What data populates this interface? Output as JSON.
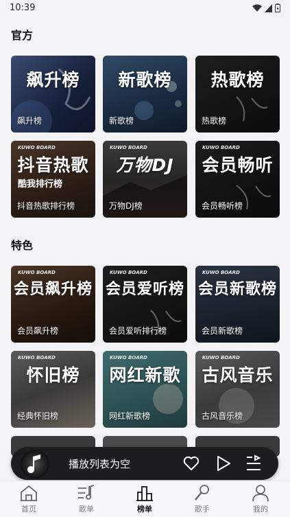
{
  "status": {
    "time": "10:39"
  },
  "sections": {
    "official": "官方",
    "featured": "特色"
  },
  "official_cards": [
    {
      "big": "飙升榜",
      "caption": "飙升榜"
    },
    {
      "big": "新歌榜",
      "caption": "新歌榜"
    },
    {
      "big": "热歌榜",
      "caption": "热歌榜"
    },
    {
      "big": "抖音热歌",
      "sub": "酷我排行榜",
      "board": "KUWO BOARD",
      "caption": "抖音热歌排行榜"
    },
    {
      "big": "万物DJ",
      "board": "KUWO BOARD",
      "caption": "万物DJ榜"
    },
    {
      "big": "会员畅听",
      "board": "KUWO BOARD",
      "caption": "会员畅听榜"
    }
  ],
  "featured_cards": [
    {
      "big": "会员飙升榜",
      "board": "KUWO BOARD",
      "caption": "会员飙升榜"
    },
    {
      "big": "会员爱听榜",
      "board": "KUWO BOARD",
      "caption": "会员爱听排行榜"
    },
    {
      "big": "会员新歌榜",
      "board": "KUWO BOARD",
      "caption": "会员新歌榜"
    },
    {
      "big": "怀旧榜",
      "board": "KUWO BOARD",
      "caption": "经典怀旧榜"
    },
    {
      "big": "网红新歌",
      "board": "KUWO BOARD",
      "caption": "网红新歌榜"
    },
    {
      "big": "古风音乐",
      "board": "KUWO BOARD",
      "caption": "古风音乐榜"
    }
  ],
  "player": {
    "status_text": "播放列表为空"
  },
  "tabs": [
    {
      "label": "首页",
      "icon": "home-icon"
    },
    {
      "label": "歌单",
      "icon": "playlist-icon"
    },
    {
      "label": "榜单",
      "icon": "chart-icon",
      "active": true
    },
    {
      "label": "歌手",
      "icon": "singer-icon"
    },
    {
      "label": "我的",
      "icon": "profile-icon"
    }
  ],
  "colors": {
    "accent": "#111111",
    "player_bg": "#1d1d1f",
    "page_bg": "#f3f3f6"
  }
}
